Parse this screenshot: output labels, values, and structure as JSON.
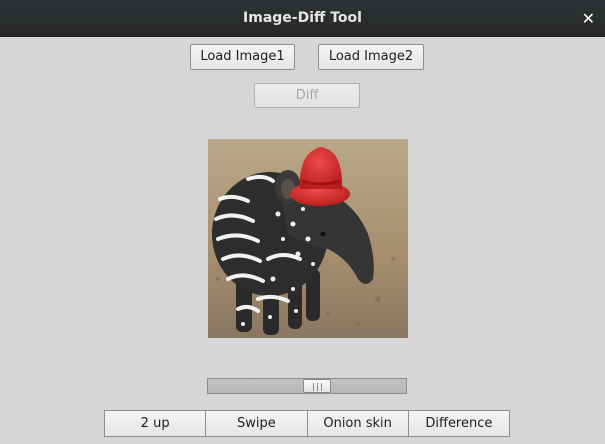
{
  "window": {
    "title": "Image-Diff Tool",
    "close_glyph": "✕"
  },
  "toolbar": {
    "load_image1_label": "Load Image1",
    "load_image2_label": "Load Image2",
    "diff_label": "Diff",
    "diff_enabled": false
  },
  "preview": {
    "description_icon": "tapir-with-red-hat-photo"
  },
  "slider": {
    "value_fraction": 0.56
  },
  "modes": [
    {
      "label": "2 up"
    },
    {
      "label": "Swipe"
    },
    {
      "label": "Onion skin"
    },
    {
      "label": "Difference"
    }
  ],
  "colors": {
    "window_bg": "#d6d6d6",
    "titlebar_bg": "#2b2d2e",
    "hat_red": "#d92b2b"
  }
}
